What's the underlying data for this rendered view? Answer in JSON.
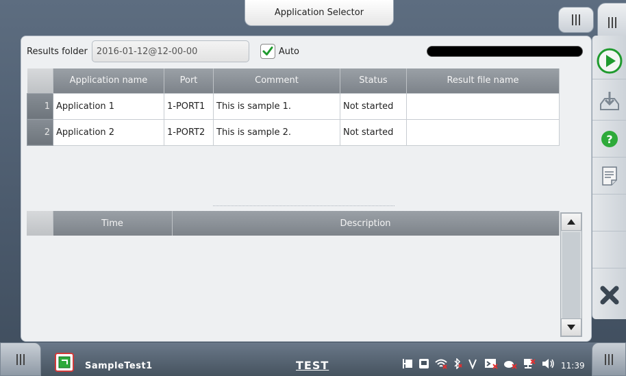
{
  "window": {
    "title": "Application Selector"
  },
  "toolbar": {
    "results_folder_label": "Results folder",
    "results_folder_value": "2016-01-12@12-00-00",
    "auto_label": "Auto",
    "auto_checked": true,
    "progress": 0.0
  },
  "app_table": {
    "columns": [
      "Application name",
      "Port",
      "Comment",
      "Status",
      "Result file name"
    ],
    "rows": [
      {
        "num": "1",
        "name": "Application 1",
        "port": "1-PORT1",
        "comment": "This is sample 1.",
        "status": "Not started",
        "result_file": ""
      },
      {
        "num": "2",
        "name": "Application 2",
        "port": "1-PORT2",
        "comment": "This is sample 2.",
        "status": "Not started",
        "result_file": ""
      }
    ]
  },
  "log_table": {
    "columns": [
      "Time",
      "Description"
    ]
  },
  "right_toolbar": {
    "items": [
      "play-icon",
      "save-icon",
      "help-icon",
      "report-icon",
      "blank",
      "blank",
      "blank",
      "close-icon"
    ]
  },
  "status_bar": {
    "app_name": "SampleTest1",
    "mode": "TEST",
    "clock": "11:39"
  },
  "colors": {
    "accent_green": "#1f9a2e",
    "header_gray": "#8a9096",
    "close_dark": "#3a4652"
  }
}
